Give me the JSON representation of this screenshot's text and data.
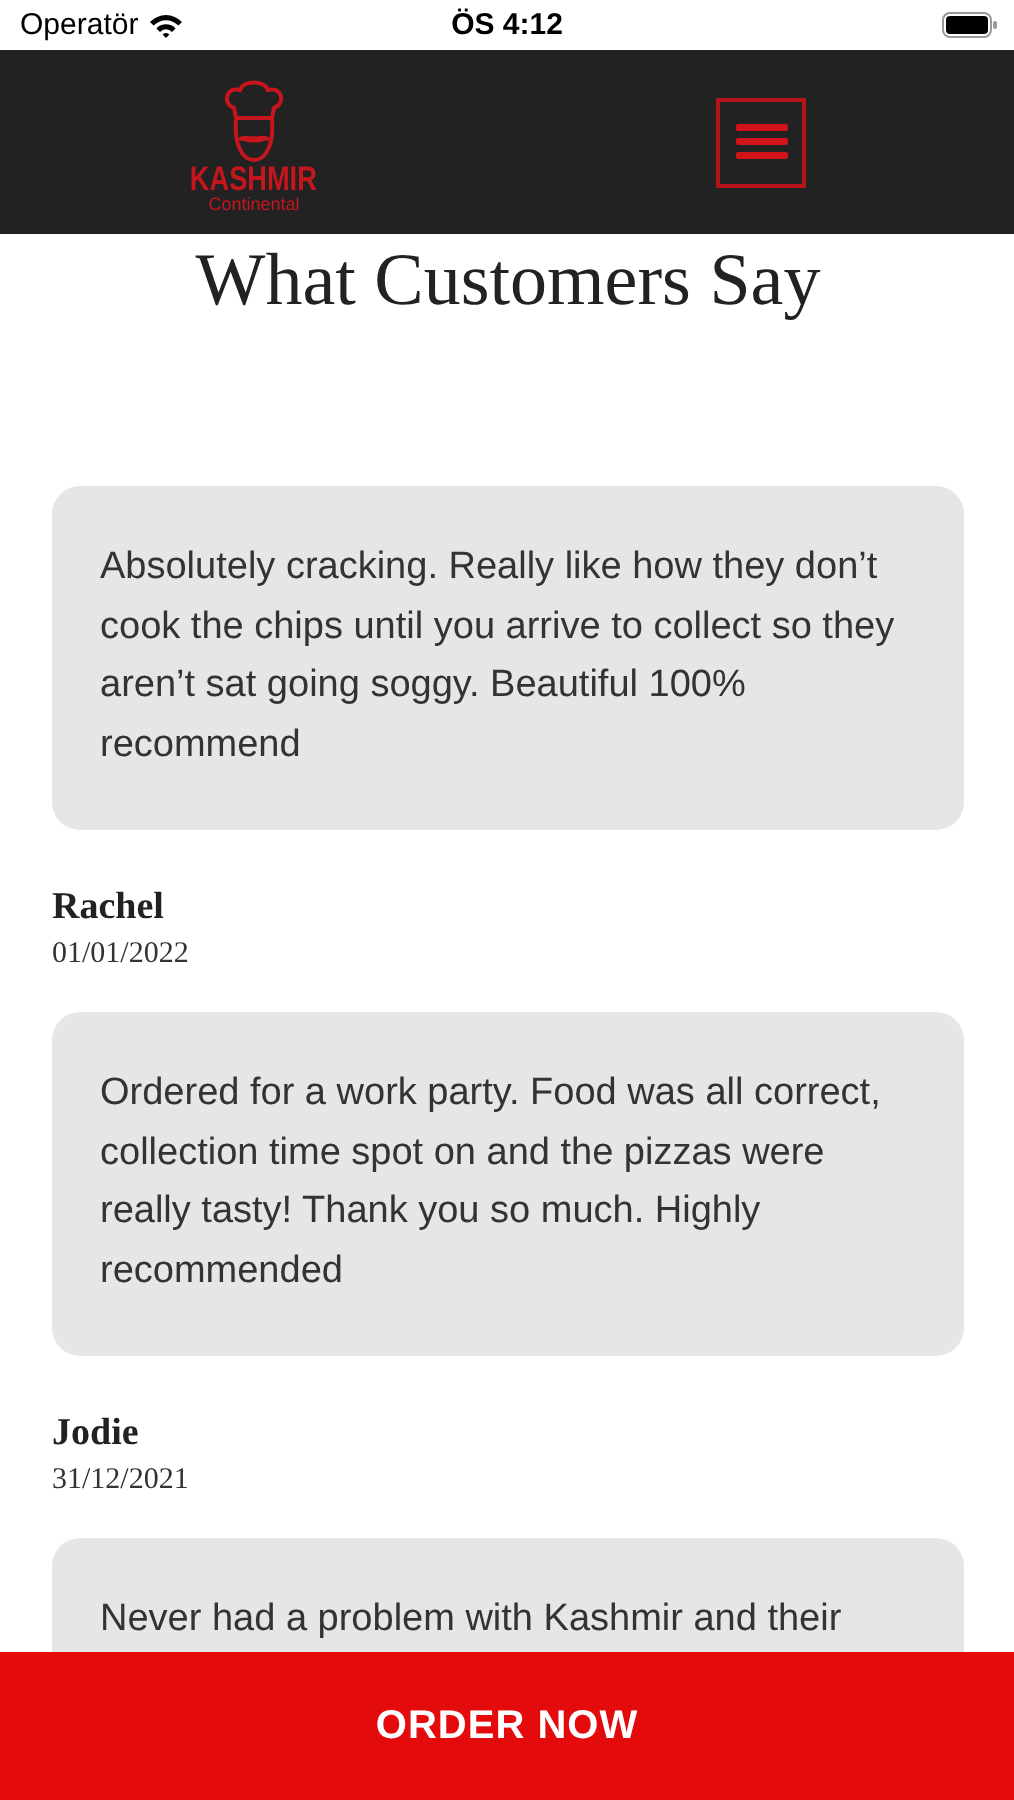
{
  "status_bar": {
    "carrier": "Operatör",
    "time": "ÖS 4:12"
  },
  "header": {
    "logo_name": "KASHMIR",
    "logo_sub": "Continental"
  },
  "title": "What Customers Say",
  "reviews": [
    {
      "text": "Absolutely cracking. Really like how they don’t cook the chips until you arrive to collect so they aren’t sat going soggy. Beautiful 100% recommend",
      "author": "Rachel",
      "date": "01/01/2022"
    },
    {
      "text": "Ordered for a work party. Food was all correct, collection time spot on and the pizzas were really tasty! Thank you so much. Highly recommended",
      "author": "Jodie",
      "date": "31/12/2021"
    },
    {
      "text": "Never had a problem with Kashmir and their"
    }
  ],
  "order_button": "ORDER NOW"
}
